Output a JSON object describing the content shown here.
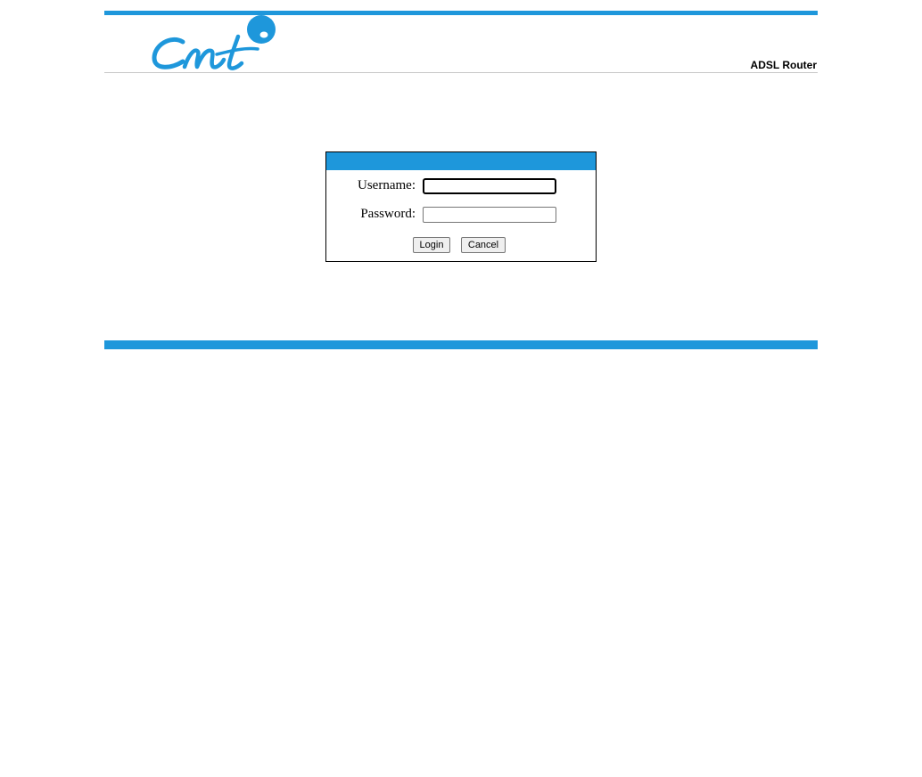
{
  "header": {
    "logo_text": "Cnt",
    "product_name": "ADSL Router"
  },
  "login": {
    "username_label": "Username:",
    "password_label": "Password:",
    "username_value": "",
    "password_value": "",
    "login_button": "Login",
    "cancel_button": "Cancel"
  },
  "colors": {
    "accent": "#1e97db"
  }
}
